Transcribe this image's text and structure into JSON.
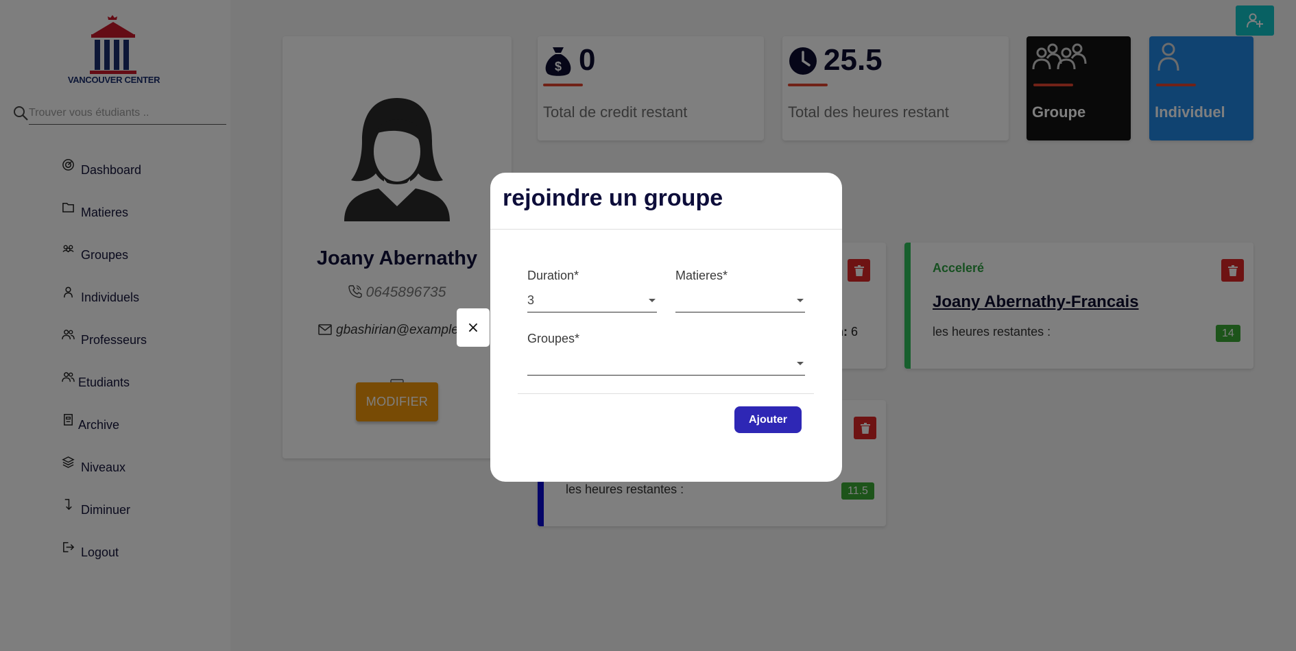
{
  "sidebar": {
    "logo_text": "VANCOUVER CENTER",
    "search_placeholder": "Trouver vous étudiants ..",
    "items": [
      {
        "label": "Dashboard",
        "icon": "dashboard-icon"
      },
      {
        "label": "Matieres",
        "icon": "folder-icon"
      },
      {
        "label": "Groupes",
        "icon": "group-icon"
      },
      {
        "label": "Individuels",
        "icon": "user-icon"
      },
      {
        "label": "Professeurs",
        "icon": "users-icon"
      },
      {
        "label": "Etudiants",
        "icon": "users-icon"
      },
      {
        "label": "Archive",
        "icon": "archive-icon"
      },
      {
        "label": "Niveaux",
        "icon": "layers-icon"
      },
      {
        "label": "Diminuer",
        "icon": "arrow-down-icon"
      },
      {
        "label": "Logout",
        "icon": "logout-icon"
      }
    ]
  },
  "profile": {
    "name": "Joany Abernathy",
    "phone": "0645896735",
    "email": "gbashirian@example.",
    "modify_label": "MODIFIER"
  },
  "stats": {
    "credit_value": "0",
    "credit_label": "Total de credit restant",
    "hours_value": "25.5",
    "hours_label": "Total des heures restant",
    "groupe_label": "Groupe",
    "individuel_label": "Individuel"
  },
  "courses": {
    "course1": {
      "meta_label": "on:",
      "meta_value": "6"
    },
    "course2": {
      "type": "Acceleré",
      "title": "Joany Abernathy-Francais",
      "hours_label": "les heures restantes :",
      "hours": "14"
    },
    "course3": {
      "hours_label": "les heures restantes :",
      "hours": "11.5"
    }
  },
  "modal": {
    "close_label": "×",
    "title": "rejoindre un groupe",
    "duration_label": "Duration*",
    "duration_value": "3",
    "matieres_label": "Matieres*",
    "matieres_value": "",
    "groupes_label": "Groupes*",
    "groupes_value": "",
    "submit_label": "Ajouter"
  },
  "colors": {
    "add_user_button": "#10c2c6",
    "modify_button": "#f0970a",
    "stat_bar": "#e2452f",
    "groupe_card": "#121212",
    "individuel_card": "#2186e3",
    "trash_button": "#dc2626",
    "hours_badge": "#3aa935",
    "ajouter_button": "#2e27b5"
  }
}
